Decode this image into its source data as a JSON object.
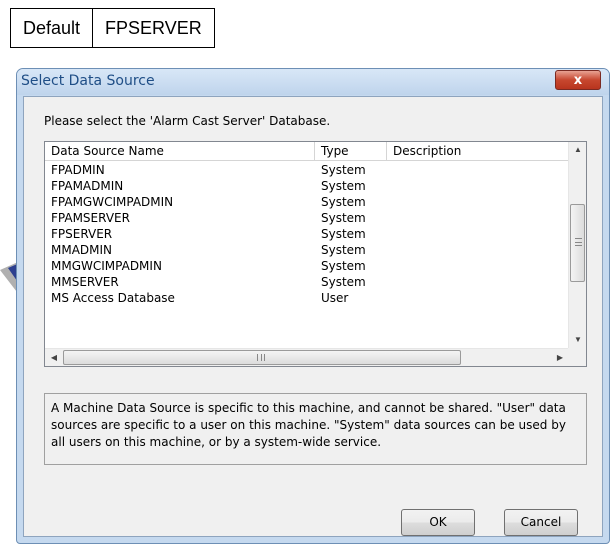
{
  "top_table": {
    "cells": [
      "Default",
      "FPSERVER"
    ]
  },
  "dialog": {
    "title": "Select Data Source",
    "close_glyph": "x",
    "prompt": "Please select the 'Alarm Cast Server' Database.",
    "columns": [
      "Data Source Name",
      "Type",
      "Description"
    ],
    "rows": [
      {
        "name": "FPADMIN",
        "type": "System",
        "description": ""
      },
      {
        "name": "FPAMADMIN",
        "type": "System",
        "description": ""
      },
      {
        "name": "FPAMGWCIMPADMIN",
        "type": "System",
        "description": ""
      },
      {
        "name": "FPAMSERVER",
        "type": "System",
        "description": ""
      },
      {
        "name": "FPSERVER",
        "type": "System",
        "description": ""
      },
      {
        "name": "MMADMIN",
        "type": "System",
        "description": ""
      },
      {
        "name": "MMGWCIMPADMIN",
        "type": "System",
        "description": ""
      },
      {
        "name": "MMSERVER",
        "type": "System",
        "description": ""
      },
      {
        "name": "MS Access Database",
        "type": "User",
        "description": ""
      }
    ],
    "info_text": "A Machine Data Source is specific to this machine, and cannot be shared. \"User\" data sources are specific to a user on this machine.  \"System\" data sources can be used by all users on this machine, or by a system-wide service.",
    "ok_label": "OK",
    "cancel_label": "Cancel"
  },
  "colors": {
    "title_text": "#1f4e86",
    "close_button": "#c7472f",
    "pointer_arrow": "#2c3f8f",
    "dialog_frame": "#c5d9ef"
  },
  "icons": {
    "scroll_up": "scroll-up-icon",
    "scroll_down": "scroll-down-icon",
    "scroll_left": "scroll-left-icon",
    "scroll_right": "scroll-right-icon",
    "pointer": "pointer-arrow-icon"
  }
}
